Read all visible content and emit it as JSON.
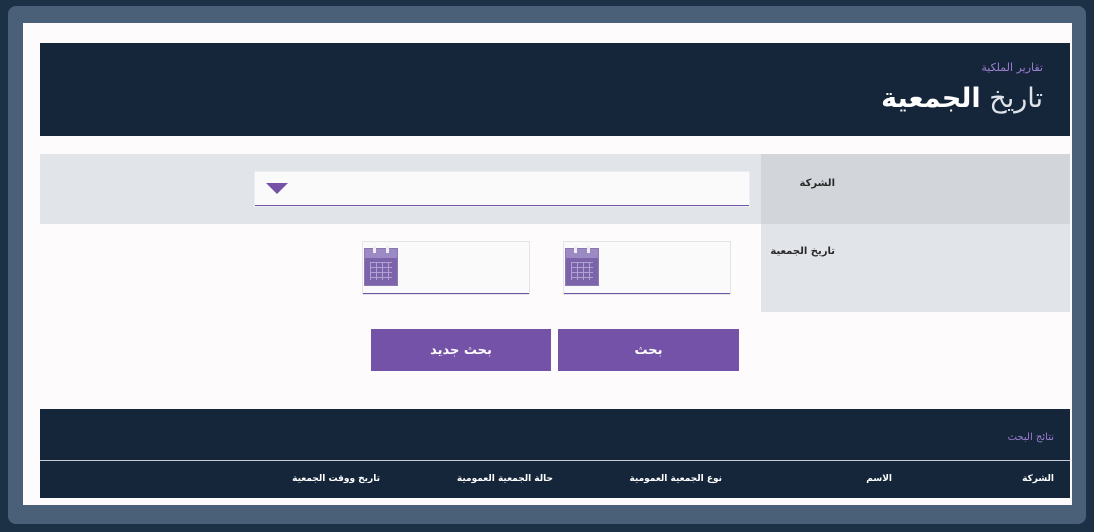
{
  "header": {
    "breadcrumb": "تقارير الملكية",
    "title_light": "تاريخ",
    "title_bold": "الجمعية"
  },
  "form": {
    "company_label": "الشركة",
    "date_label": "تاريخ الجمعية",
    "company_select_value": "",
    "date_from_value": "",
    "date_to_value": ""
  },
  "buttons": {
    "search": "بحث",
    "new_search": "بحث جديد"
  },
  "results": {
    "title": "نتائج البحث",
    "columns": [
      "الشركة",
      "الاسم",
      "نوع الجمعية العمومية",
      "حالة الجمعية العمومية",
      "تاريخ ووقت الجمعية"
    ]
  },
  "icons": {
    "dropdown": "caret-down-icon",
    "date": "calendar-icon"
  },
  "colors": {
    "header_bg": "#15263a",
    "accent": "#7352a8",
    "accent_text": "#9b7fd0",
    "frame": "#4a6079"
  }
}
